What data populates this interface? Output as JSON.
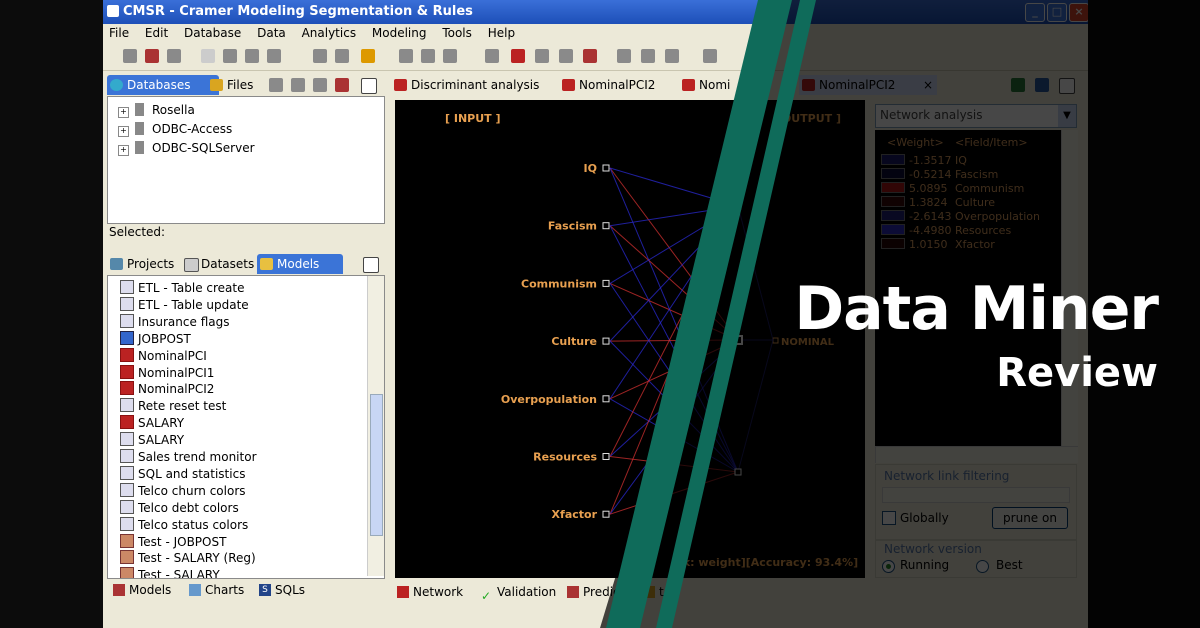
{
  "window": {
    "title": "CMSR - Cramer Modeling Segmentation & Rules",
    "controls": [
      "minimize-icon",
      "maximize-icon",
      "close-icon"
    ]
  },
  "menu": [
    "File",
    "Edit",
    "Database",
    "Data",
    "Analytics",
    "Modeling",
    "Tools",
    "Help"
  ],
  "left_top_tabs": [
    "Databases",
    "Files"
  ],
  "databases": [
    "Rosella",
    "ODBC-Access",
    "ODBC-SQLServer"
  ],
  "selected_label": "Selected:",
  "left_mid_tabs": [
    "Projects",
    "Datasets",
    "Models"
  ],
  "models": [
    {
      "label": "ETL - Table create",
      "icon": "model"
    },
    {
      "label": "ETL - Table update",
      "icon": "model"
    },
    {
      "label": "Insurance flags",
      "icon": "model"
    },
    {
      "label": "JOBPOST",
      "icon": "tree"
    },
    {
      "label": "NominalPCI",
      "icon": "net"
    },
    {
      "label": "NominalPCI1",
      "icon": "net"
    },
    {
      "label": "NominalPCI2",
      "icon": "net"
    },
    {
      "label": "Rete reset test",
      "icon": "model"
    },
    {
      "label": "SALARY",
      "icon": "net"
    },
    {
      "label": "SALARY",
      "icon": "chart"
    },
    {
      "label": "Sales trend monitor",
      "icon": "model"
    },
    {
      "label": "SQL and statistics",
      "icon": "model"
    },
    {
      "label": "Telco churn colors",
      "icon": "model"
    },
    {
      "label": "Telco debt colors",
      "icon": "model"
    },
    {
      "label": "Telco status colors",
      "icon": "model"
    },
    {
      "label": "Test - JOBPOST",
      "icon": "edit"
    },
    {
      "label": "Test - SALARY (Reg)",
      "icon": "edit"
    },
    {
      "label": "Test - SALARY",
      "icon": "edit"
    }
  ],
  "left_bottom_tabs": [
    "Models",
    "Charts",
    "SQLs"
  ],
  "editor_tabs": [
    "Discriminant analysis",
    "NominalPCI2",
    "Nomi",
    "NominalPCI2"
  ],
  "network": {
    "input_header": "[ INPUT ]",
    "output_header": "[ OUTPUT ]",
    "inputs": [
      "IQ",
      "Fascism",
      "Communism",
      "Culture",
      "Overpopulation",
      "Resources",
      "Xfactor"
    ],
    "output": "NOMINAL",
    "footer": "nk: weight][Accuracy: 93.4%]"
  },
  "bottom_tabs": [
    "Network",
    "Validation",
    "Predic",
    "tes"
  ],
  "side": {
    "dropdown": "Network analysis",
    "legend_header_weight": "<Weight>",
    "legend_header_field": "<Field/Item>",
    "legend": [
      {
        "weight": "-1.3517",
        "field": "IQ",
        "color": "#1a1a6e"
      },
      {
        "weight": "-0.5214",
        "field": "Fascism",
        "color": "#0c0c3a"
      },
      {
        "weight": "5.0895",
        "field": "Communism",
        "color": "#b01818"
      },
      {
        "weight": "1.3824",
        "field": "Culture",
        "color": "#3a0808"
      },
      {
        "weight": "-2.6143",
        "field": "Overpopulation",
        "color": "#22227a"
      },
      {
        "weight": "-4.4980",
        "field": "Resources",
        "color": "#2d2dc0"
      },
      {
        "weight": "1.0150",
        "field": "Xfactor",
        "color": "#2a0606"
      }
    ],
    "filter_label": "Network link filtering",
    "globally_label": "Globally",
    "prune_label": "prune on",
    "version_label": "Network version",
    "running_label": "Running",
    "best_label": "Best"
  },
  "banner": {
    "title": "Data Miner",
    "subtitle": "Review"
  }
}
